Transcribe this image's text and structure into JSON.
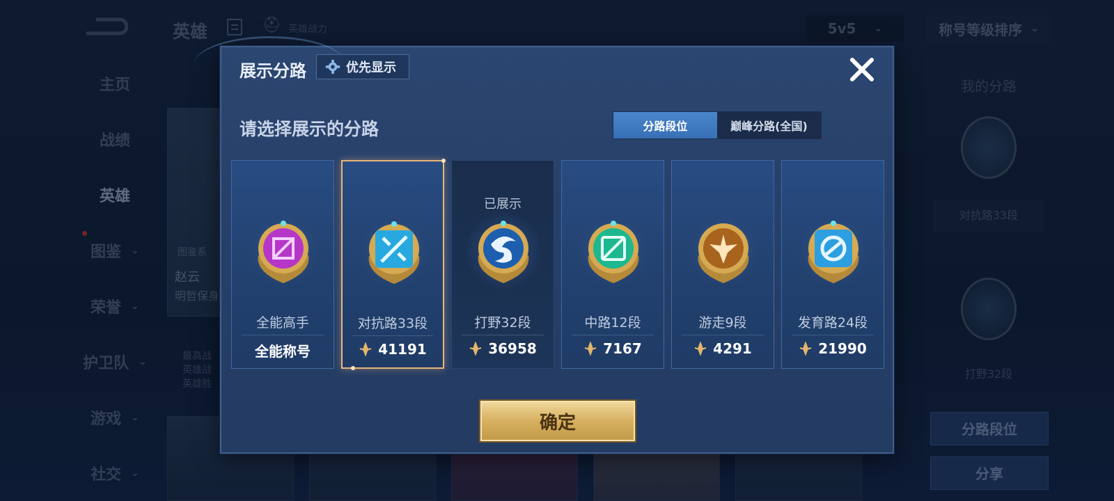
{
  "background": {
    "top_title": "英雄",
    "power_label": "英雄战力",
    "mode_select": "5v5",
    "sort_select": "称号等级排序",
    "sidebar": [
      {
        "label": "主页",
        "chevron": false,
        "active": false
      },
      {
        "label": "战绩",
        "chevron": false,
        "active": false
      },
      {
        "label": "英雄",
        "chevron": false,
        "active": true
      },
      {
        "label": "图鉴",
        "chevron": true,
        "active": false
      },
      {
        "label": "荣誉",
        "chevron": true,
        "active": false
      },
      {
        "label": "护卫队",
        "chevron": true,
        "active": false
      },
      {
        "label": "游戏",
        "chevron": true,
        "active": false
      },
      {
        "label": "社交",
        "chevron": true,
        "active": false
      }
    ],
    "hero_card": {
      "gallery": "图鉴系",
      "name": "赵云",
      "subtitle": "明哲保身"
    },
    "hero_info": [
      "最高战",
      "英雄战",
      "英雄胜"
    ],
    "right_panel": {
      "title": "我的分路",
      "lane_1": "对抗路33段",
      "lane_2": "打野32段",
      "btn_lane_rank": "分路段位",
      "btn_share": "分享"
    }
  },
  "dialog": {
    "title": "展示分路",
    "priority_button": "优先显示",
    "subtitle": "请选择展示的分路",
    "tabs": [
      {
        "label": "分路段位",
        "active": true
      },
      {
        "label": "巅峰分路(全国)",
        "active": false
      }
    ],
    "cards": [
      {
        "lane": "全能高手",
        "score": "全能称号",
        "has_score_icon": false,
        "shown": false,
        "selected": false,
        "badge_color": "#b636c8",
        "icon": "allround-emblem-icon"
      },
      {
        "lane": "对抗路33段",
        "score": "41191",
        "has_score_icon": true,
        "shown": false,
        "selected": true,
        "badge_color": "#27a9e0",
        "icon": "clash-lane-emblem-icon"
      },
      {
        "lane": "打野32段",
        "score": "36958",
        "has_score_icon": true,
        "shown": true,
        "shown_label": "已展示",
        "selected": false,
        "badge_color": "#1d5fae",
        "icon": "jungle-emblem-icon"
      },
      {
        "lane": "中路12段",
        "score": "7167",
        "has_score_icon": true,
        "shown": false,
        "selected": false,
        "badge_color": "#1db88f",
        "icon": "mid-lane-emblem-icon"
      },
      {
        "lane": "游走9段",
        "score": "4291",
        "has_score_icon": true,
        "shown": false,
        "selected": false,
        "badge_color": "#a8641e",
        "icon": "roam-emblem-icon"
      },
      {
        "lane": "发育路24段",
        "score": "21990",
        "has_score_icon": true,
        "shown": false,
        "selected": false,
        "badge_color": "#2d9fe0",
        "icon": "farm-lane-emblem-icon"
      }
    ],
    "confirm_button": "确定"
  }
}
